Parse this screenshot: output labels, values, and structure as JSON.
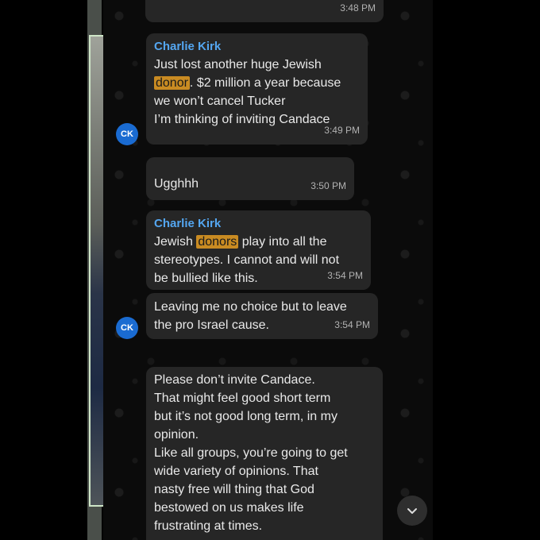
{
  "messages": {
    "m0": {
      "time": "3:48 PM"
    },
    "m1": {
      "sender": "Charlie Kirk",
      "l1": "Just lost another huge Jewish",
      "l2_hl": "donor",
      "l2_rest": ". $2 million a year because",
      "l3": "we won’t cancel Tucker",
      "l4": "I’m thinking of inviting Candace",
      "time": "3:49 PM"
    },
    "m2": {
      "text": "Ugghhh",
      "time": "3:50 PM"
    },
    "m3": {
      "sender": "Charlie Kirk",
      "l1_pre": "Jewish ",
      "l1_hl": "donors",
      "l1_post": " play into all the",
      "l2": "stereotypes. I cannot and will not",
      "l3": "be bullied like this.",
      "time": "3:54 PM"
    },
    "m4": {
      "l1": "Leaving me no choice but to leave",
      "l2": "the pro Israel cause.",
      "time": "3:54 PM"
    },
    "m5": {
      "lines": [
        "Please don’t invite Candace.",
        "That might feel good short term",
        "but it’s not good long term, in my",
        "opinion.",
        "Like all groups, you’re going to get",
        "wide variety of opinions.  That",
        "nasty free will thing that God",
        "bestowed on us makes life",
        "frustrating at times."
      ]
    }
  },
  "avatars": {
    "ck_initials": "CK"
  },
  "colors": {
    "sender": "#54a6f0",
    "highlight": "#c98b22",
    "bubble": "#262626",
    "avatar": "#1a6bd1"
  },
  "icons": {
    "scroll_down": "chevron-down-icon"
  }
}
